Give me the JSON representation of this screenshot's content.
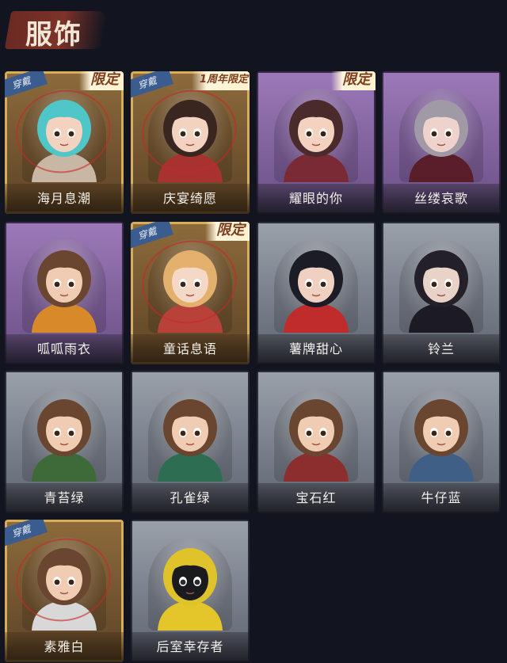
{
  "header": {
    "title": "服饰"
  },
  "cards": [
    {
      "name": "海月息潮",
      "worn": "穿戴",
      "tag": "限定",
      "rarity": "gold",
      "hair": "#4fc7c8",
      "skin": "#f3d2c0",
      "cloth": "#c9b7a6"
    },
    {
      "name": "庆宴绮愿",
      "worn": "穿戴",
      "tag": "1周年限定",
      "rarity": "gold",
      "hair": "#3a2620",
      "skin": "#f3d2c0",
      "cloth": "#a8322f"
    },
    {
      "name": "耀眼的你",
      "worn": "",
      "tag": "限定",
      "rarity": "purple",
      "hair": "#4a2a2a",
      "skin": "#f3d2c0",
      "cloth": "#7a2a34"
    },
    {
      "name": "丝缕哀歌",
      "worn": "",
      "tag": "",
      "rarity": "purple",
      "hair": "#a09aa6",
      "skin": "#efd2cc",
      "cloth": "#5a1d2a"
    },
    {
      "name": "呱呱雨衣",
      "worn": "",
      "tag": "",
      "rarity": "purple",
      "hair": "#6a4630",
      "skin": "#f0ccb2",
      "cloth": "#d88a2a"
    },
    {
      "name": "童话息语",
      "worn": "穿戴",
      "tag": "限定",
      "rarity": "gold",
      "hair": "#e3b06d",
      "skin": "#f6d8c6",
      "cloth": "#b8413a"
    },
    {
      "name": "薯牌甜心",
      "worn": "",
      "tag": "",
      "rarity": "grey",
      "hair": "#1c1c26",
      "skin": "#f0d0c0",
      "cloth": "#c02b2b"
    },
    {
      "name": "铃兰",
      "worn": "",
      "tag": "",
      "rarity": "grey",
      "hair": "#24202a",
      "skin": "#e9d2c8",
      "cloth": "#1c1a22"
    },
    {
      "name": "青苔绿",
      "worn": "",
      "tag": "",
      "rarity": "grey",
      "hair": "#6a4630",
      "skin": "#f0ccb2",
      "cloth": "#3e6a3a"
    },
    {
      "name": "孔雀绿",
      "worn": "",
      "tag": "",
      "rarity": "grey",
      "hair": "#6a4630",
      "skin": "#f0ccb2",
      "cloth": "#2d6e52"
    },
    {
      "name": "宝石红",
      "worn": "",
      "tag": "",
      "rarity": "grey",
      "hair": "#6a4630",
      "skin": "#f0ccb2",
      "cloth": "#8c2e2e"
    },
    {
      "name": "牛仔蓝",
      "worn": "",
      "tag": "",
      "rarity": "grey",
      "hair": "#6a4630",
      "skin": "#f0ccb2",
      "cloth": "#3f5f86"
    },
    {
      "name": "素雅白",
      "worn": "穿戴",
      "tag": "",
      "rarity": "gold",
      "hair": "#6a4630",
      "skin": "#f0ccb2",
      "cloth": "#d8d8d8"
    },
    {
      "name": "后室幸存者",
      "worn": "",
      "tag": "",
      "rarity": "grey",
      "hair": "#e0c22a",
      "skin": "#1b1b1f",
      "cloth": "#e4c62b"
    }
  ]
}
